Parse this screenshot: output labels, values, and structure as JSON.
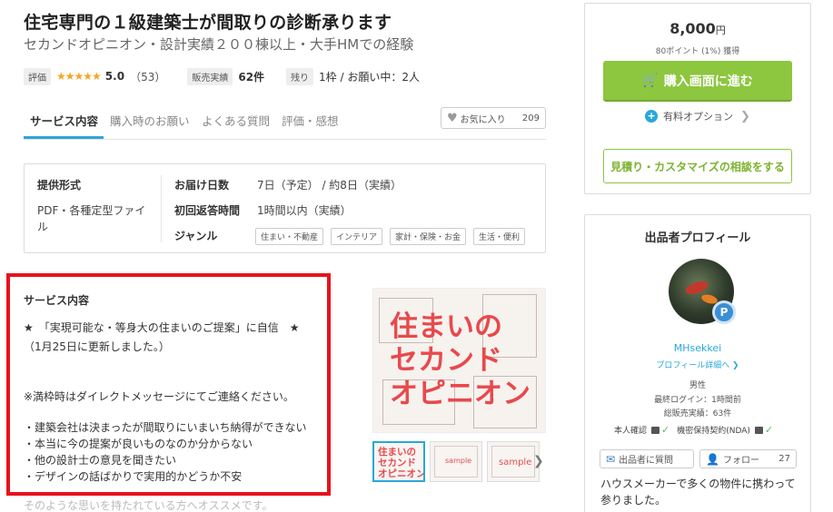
{
  "header": {
    "title": "住宅専門の１級建築士が間取りの診断承ります",
    "subtitle": "セカンドオピニオン・設計実績２００棟以上・大手HMでの経験"
  },
  "meta": {
    "rating_label": "評価",
    "stars": "★★★★★",
    "rating": "5.0",
    "review_count": "（53）",
    "sales_label": "販売実績",
    "sales_value": "62件",
    "remaining_label": "残り",
    "remaining_value": "1枠 / お願い中：2人"
  },
  "tabs": [
    {
      "label": "サービス内容",
      "active": true
    },
    {
      "label": "購入時のお願い",
      "active": false
    },
    {
      "label": "よくある質問",
      "active": false
    },
    {
      "label": "評価・感想",
      "active": false
    }
  ],
  "favorite": {
    "label": "お気に入り",
    "count": "209"
  },
  "info": {
    "format_label": "提供形式",
    "format_value_1": "PDF・各種定型ファイ",
    "format_value_2": "ル",
    "delivery_label": "お届け日数",
    "delivery_value": "7日（予定） / 約8日（実績）",
    "reply_label": "初回返答時間",
    "reply_value": "1時間以内（実績）",
    "genre_label": "ジャンル",
    "genres": [
      "住まい・不動産",
      "インテリア",
      "家計・保険・お金",
      "生活・便利"
    ]
  },
  "service": {
    "heading": "サービス内容",
    "lines": [
      "★　「実現可能な・等身大の住まいのご提案」に自信　★",
      "（1月25日に更新しました。）",
      "※満枠時はダイレクトメッセージにてご連絡ください。",
      "・建築会社は決まったが間取りにいまいち納得ができない",
      "・本当に今の提案が良いものなのか分からない",
      "・他の設計士の意見を聞きたい",
      "・デザインの話ばかりで実用的かどうか不安"
    ],
    "faded_line": "そのような思いを持たれている方へオススメです。"
  },
  "gallery": {
    "main_text_1": "住まいの",
    "main_text_2": "セカンド",
    "main_text_3": "オピニオン",
    "thumb1_1": "住まいの",
    "thumb1_2": "セカンド",
    "thumb1_3": "オピニオン",
    "thumb_sample": "sample"
  },
  "purchase": {
    "price": "8,000",
    "yen": "円",
    "points": "80ポイント (1%) 獲得",
    "buy_label": "購入画面に進む",
    "option_label": "有料オプション",
    "quote_label": "見積り・カスタマイズの相談をする"
  },
  "profile": {
    "title": "出品者プロフィール",
    "badge": "P",
    "username": "MHsekkei",
    "detail_link": "プロフィール詳細へ ❯",
    "gender": "男性",
    "last_login": "最終ログイン：1時間前",
    "total_sales": "総販売実績：63件",
    "identity_label": "本人確認",
    "nda_label": "機密保持契約(NDA)",
    "ask_label": "出品者に質問",
    "follow_label": "フォロー",
    "follow_count": "27",
    "bio": "ハウスメーカーで多くの物件に携わって参りました。"
  },
  "colors": {
    "accent_blue": "#2aa7d8",
    "buy_green": "#8dc63f",
    "highlight_red": "#e8111b",
    "star": "#f5a623"
  }
}
